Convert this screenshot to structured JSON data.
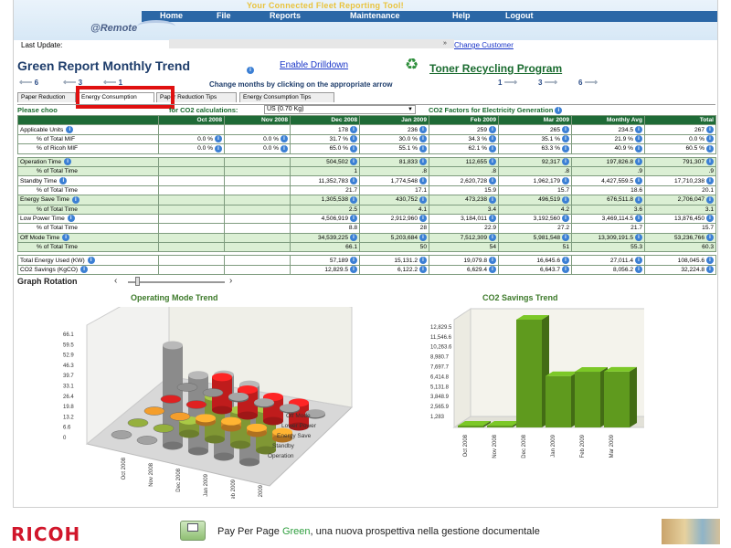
{
  "header": {
    "app_title": "Your Connected Fleet Reporting Tool!",
    "nav": [
      "Home",
      "File",
      "Reports",
      "Maintenance",
      "Help",
      "Logout"
    ],
    "logo": "@Remote",
    "last_update_label": "Last Update:",
    "last_update_value": "",
    "change_customer": "Change Customer"
  },
  "title": {
    "text": "Green Report Monthly Trend",
    "enable_drilldown": "Enable Drilldown",
    "toner_recycling": "Toner Recycling Program"
  },
  "month_nav": {
    "left_values": [
      "6",
      "3",
      "1"
    ],
    "hint": "Change months by clicking on the appropriate arrow",
    "right_values": [
      "1",
      "3",
      "6"
    ]
  },
  "tabs": [
    "Paper Reduction",
    "Energy Consumption",
    "Paper Reduction Tips",
    "Energy Consumption Tips"
  ],
  "active_tab": "Energy Consumption",
  "co2": {
    "label_left": "Please choo",
    "label_right": "for CO2 calculations:",
    "selected": "US (0.70 Kg)",
    "factors_link": "CO2 Factors for Electricity Generation"
  },
  "table": {
    "headers": [
      "",
      "Oct 2008",
      "Nov 2008",
      "Dec 2008",
      "Jan 2009",
      "Feb 2009",
      "Mar 2009",
      "Monthly Avg",
      "Total"
    ],
    "rows": [
      {
        "label": "Applicable Units",
        "sub": false,
        "green": false,
        "info": true,
        "cells": [
          "",
          "",
          "178",
          "236",
          "259",
          "265",
          "234.5",
          "267"
        ]
      },
      {
        "label": "% of Total MIF",
        "sub": true,
        "green": false,
        "info": false,
        "cells": [
          "0.0 %",
          "0.0 %",
          "31.7 %",
          "30.0 %",
          "34.3 %",
          "35.1 %",
          "21.9 %",
          "0.0 %"
        ]
      },
      {
        "label": "% of Ricoh MIF",
        "sub": true,
        "green": false,
        "info": false,
        "cells": [
          "0.0 %",
          "0.0 %",
          "65.0 %",
          "55.1 %",
          "62.1 %",
          "63.3 %",
          "40.9 %",
          "60.5 %"
        ]
      },
      {
        "spacer": true
      },
      {
        "label": "Operation Time",
        "sub": false,
        "green": true,
        "info": true,
        "cells": [
          "",
          "",
          "504,502",
          "81,833",
          "112,655",
          "92,317",
          "197,826.8",
          "791,307"
        ]
      },
      {
        "label": "% of Total Time",
        "sub": true,
        "green": true,
        "info": false,
        "cells": [
          "",
          "",
          "1",
          ".8",
          ".8",
          ".8",
          ".9",
          ".9"
        ]
      },
      {
        "label": "Standby Time",
        "sub": false,
        "green": false,
        "info": true,
        "cells": [
          "",
          "",
          "11,352,783",
          "1,774,548",
          "2,620,728",
          "1,962,179",
          "4,427,559.5",
          "17,710,238"
        ]
      },
      {
        "label": "% of Total Time",
        "sub": true,
        "green": false,
        "info": false,
        "cells": [
          "",
          "",
          "21.7",
          "17.1",
          "15.9",
          "15.7",
          "18.6",
          "20.1"
        ]
      },
      {
        "label": "Energy Save Time",
        "sub": false,
        "green": true,
        "info": true,
        "cells": [
          "",
          "",
          "1,305,538",
          "430,752",
          "473,238",
          "496,519",
          "676,511.8",
          "2,706,047"
        ]
      },
      {
        "label": "% of Total Time",
        "sub": true,
        "green": true,
        "info": false,
        "cells": [
          "",
          "",
          "2.5",
          "4.1",
          "3.4",
          "4.2",
          "3.6",
          "3.1"
        ]
      },
      {
        "label": "Low Power Time",
        "sub": false,
        "green": false,
        "info": true,
        "cells": [
          "",
          "",
          "4,506,919",
          "2,912,960",
          "3,184,011",
          "3,192,560",
          "3,469,114.5",
          "13,876,450"
        ]
      },
      {
        "label": "% of Total Time",
        "sub": true,
        "green": false,
        "info": false,
        "cells": [
          "",
          "",
          "8.8",
          "28",
          "22.9",
          "27.2",
          "21.7",
          "15.7"
        ]
      },
      {
        "label": "Off Mode Time",
        "sub": false,
        "green": true,
        "info": true,
        "cells": [
          "",
          "",
          "34,539,225",
          "5,203,684",
          "7,512,309",
          "5,981,548",
          "13,309,191.5",
          "53,236,766"
        ]
      },
      {
        "label": "% of Total Time",
        "sub": true,
        "green": true,
        "info": false,
        "cells": [
          "",
          "",
          "66.1",
          "50",
          "54",
          "51",
          "55.3",
          "60.3"
        ]
      },
      {
        "spacer": true
      },
      {
        "label": "Total Energy Used (KW)",
        "sub": false,
        "green": false,
        "info": true,
        "cells": [
          "",
          "",
          "57,189",
          "15,131.2",
          "19,079.8",
          "16,645.6",
          "27,011.4",
          "108,045.6"
        ]
      },
      {
        "label": "CO2 Savings (KgCO)",
        "sub": false,
        "green": false,
        "info": true,
        "cells": [
          "",
          "",
          "12,829.5",
          "6,122.2",
          "6,629.4",
          "6,643.7",
          "8,056.2",
          "32,224.8"
        ]
      }
    ]
  },
  "graph_rotation": "Graph Rotation",
  "chart_data": [
    {
      "type": "bar",
      "title": "Operating Mode Trend",
      "categories": [
        "Oct 2008",
        "Nov 2008",
        "Dec 2008",
        "Jan 2009",
        "Feb 2009",
        "Mar 2009"
      ],
      "ytick_labels": [
        "0",
        "6.6",
        "13.2",
        "19.8",
        "26.4",
        "33.1",
        "39.7",
        "46.3",
        "52.9",
        "59.5",
        "66.1"
      ],
      "ylim": [
        0,
        66.1
      ],
      "series": [
        {
          "name": "Off Mode",
          "values": [
            0,
            0,
            66.1,
            50,
            54,
            51
          ],
          "color": "#9a9a9a"
        },
        {
          "name": "Lower Power",
          "values": [
            0,
            0,
            8.8,
            28,
            22.9,
            27.2
          ],
          "color": "#8ea83a"
        },
        {
          "name": "Energy Save",
          "values": [
            0,
            0,
            2.5,
            4.1,
            3.4,
            4.2
          ],
          "color": "#e8962a"
        },
        {
          "name": "Standby",
          "values": [
            0,
            0,
            21.7,
            17.1,
            15.9,
            15.7
          ],
          "color": "#d41f1f"
        },
        {
          "name": "Operation",
          "values": [
            0,
            0,
            1,
            0.8,
            0.8,
            0.8
          ],
          "color": "#8a8a8a"
        }
      ]
    },
    {
      "type": "bar",
      "title": "CO2 Savings Trend",
      "categories": [
        "Oct 2008",
        "Nov 2008",
        "Dec 2008",
        "Jan 2009",
        "Feb 2009",
        "Mar 2009"
      ],
      "values": [
        0,
        0,
        12829.5,
        6122.2,
        6629.4,
        6643.7
      ],
      "ytick_labels": [
        "1,283",
        "2,565.9",
        "3,848.9",
        "5,131.8",
        "6,414.8",
        "7,697.7",
        "8,980.7",
        "10,263.6",
        "11,546.6",
        "12,829.5"
      ],
      "ylim": [
        0,
        12829.5
      ],
      "color": "#5f9a1e"
    }
  ],
  "footer": {
    "company": "RICOH",
    "tagline_prefix": "Pay Per Page ",
    "tagline_green": "Green",
    "tagline_suffix": ", una nuova prospettiva nella gestione documentale"
  }
}
